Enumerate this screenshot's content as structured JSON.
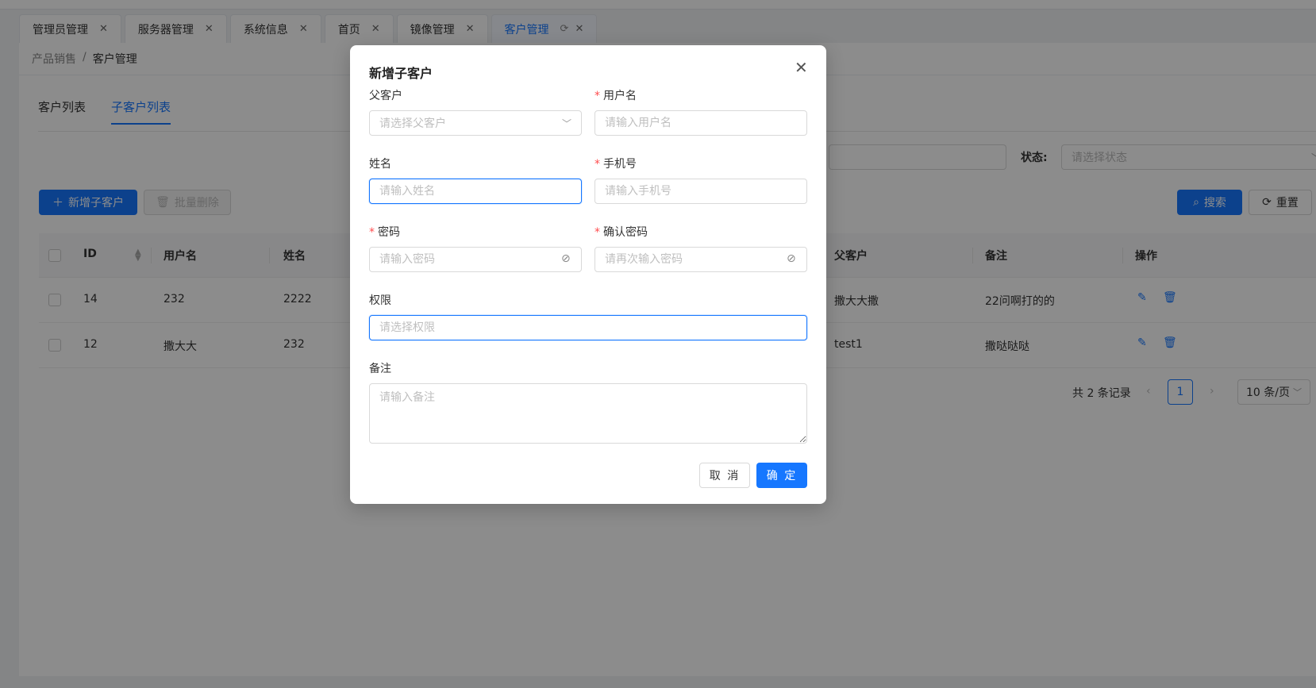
{
  "tabs": [
    {
      "label": "管理员管理"
    },
    {
      "label": "服务器管理"
    },
    {
      "label": "系统信息"
    },
    {
      "label": "首页"
    },
    {
      "label": "镜像管理"
    },
    {
      "label": "客户管理"
    }
  ],
  "breadcrumb": {
    "parent": "产品销售",
    "separator": "/",
    "current": "客户管理"
  },
  "subtabs": [
    {
      "label": "客户列表"
    },
    {
      "label": "子客户列表"
    }
  ],
  "filters": {
    "status_label": "状态:",
    "status_placeholder": "请选择状态"
  },
  "toolbar": {
    "add_label": "新增子客户",
    "batch_delete_label": "批量删除",
    "search_label": "搜索",
    "reset_label": "重置"
  },
  "table": {
    "headers": {
      "id": "ID",
      "username": "用户名",
      "name": "姓名",
      "parent": "父客户",
      "remark": "备注",
      "actions": "操作"
    },
    "rows": [
      {
        "id": "14",
        "username": "232",
        "name": "2222",
        "parent": "撒大大撒",
        "remark": "22问啊打的的"
      },
      {
        "id": "12",
        "username": "撒大大",
        "name": "232",
        "parent": "test1",
        "remark": "撒哒哒哒"
      }
    ]
  },
  "pagination": {
    "total_text": "共 2 条记录",
    "current_page": "1",
    "page_size": "10 条/页"
  },
  "modal": {
    "title": "新增子客户",
    "parent_label": "父客户",
    "parent_placeholder": "请选择父客户",
    "username_label": "用户名",
    "username_placeholder": "请输入用户名",
    "name_label": "姓名",
    "name_placeholder": "请输入姓名",
    "phone_label": "手机号",
    "phone_placeholder": "请输入手机号",
    "password_label": "密码",
    "password_placeholder": "请输入密码",
    "confirm_label": "确认密码",
    "confirm_placeholder": "请再次输入密码",
    "permission_label": "权限",
    "permission_placeholder": "请选择权限",
    "remark_label": "备注",
    "remark_placeholder": "请输入备注",
    "required_mark": "*",
    "cancel_label": "取 消",
    "ok_label": "确 定"
  },
  "colors": {
    "primary": "#1677ff",
    "required": "#ff4d4f",
    "mask": "rgba(0,0,0,0.45)"
  }
}
